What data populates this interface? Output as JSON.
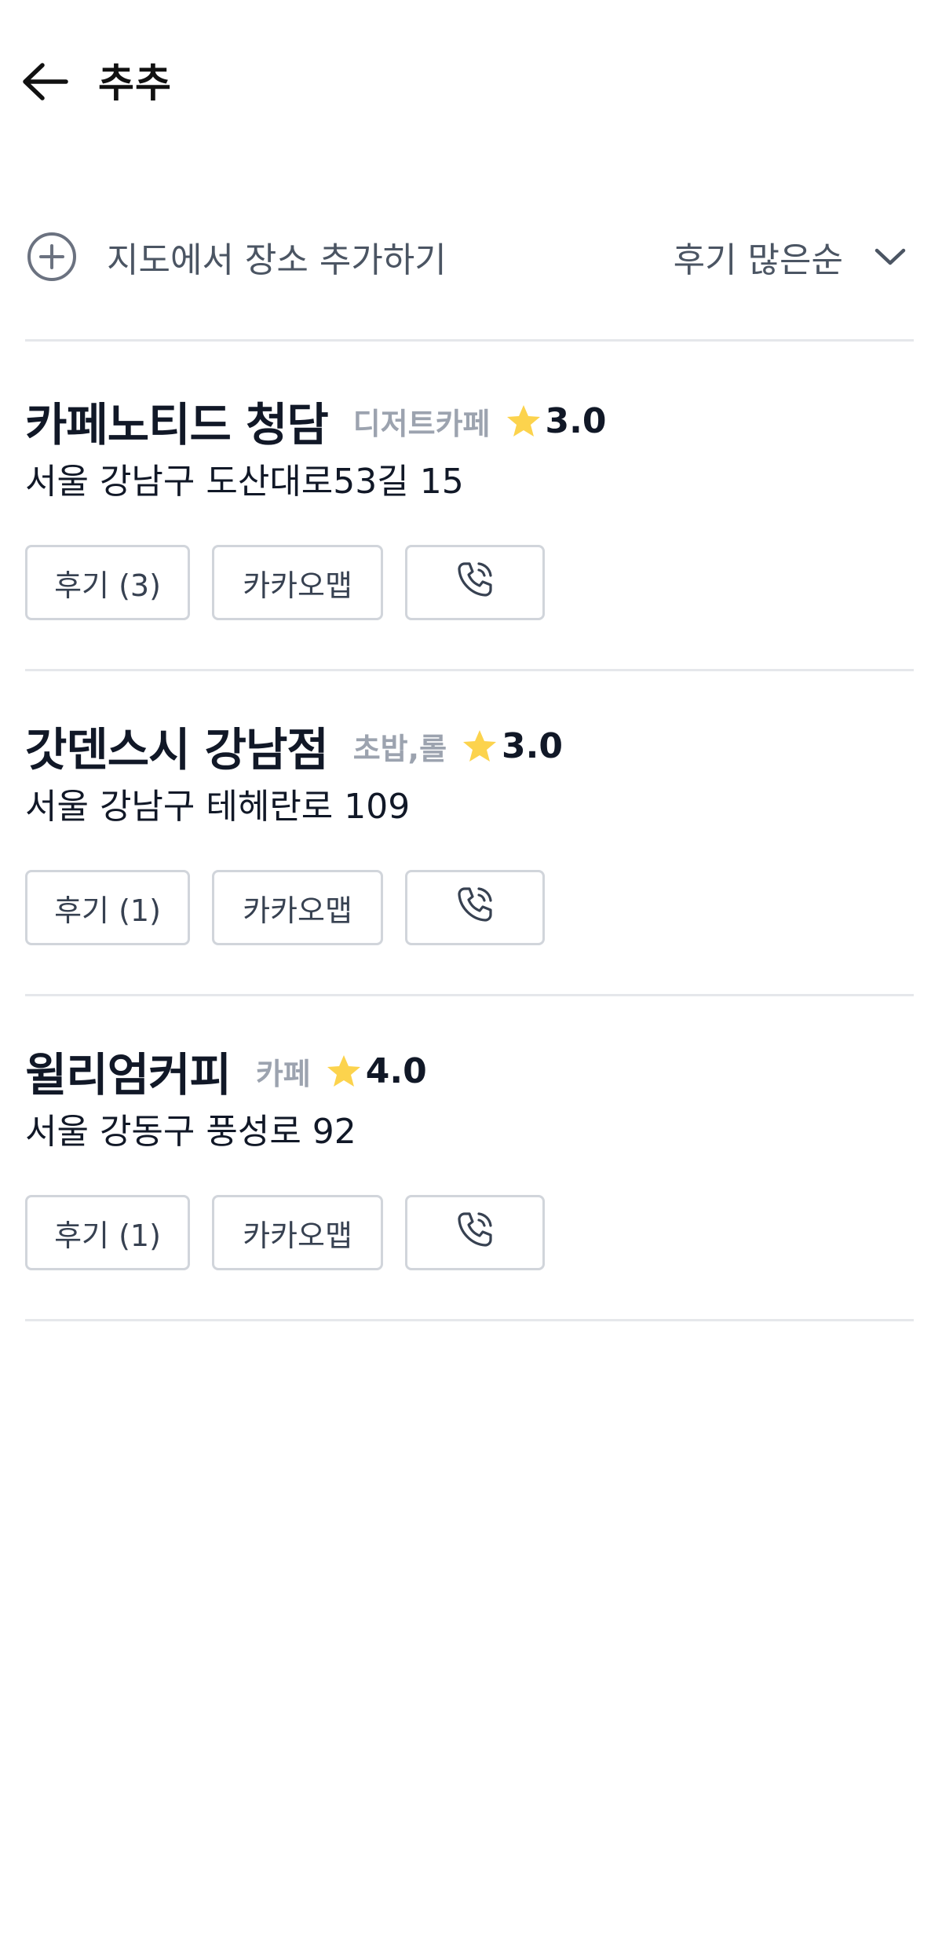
{
  "header": {
    "title": "추추",
    "back_icon": "arrow-left-icon"
  },
  "toolbar": {
    "add_place_label": "지도에서 장소 추가하기",
    "add_icon": "plus-circle-icon",
    "sort_label": "후기 많은순",
    "sort_icon": "chevron-down-icon"
  },
  "colors": {
    "text_primary": "#111827",
    "text_secondary": "#4b5563",
    "text_muted": "#9ca3af",
    "star": "#fcd34d",
    "border": "#d1d5db",
    "divider": "#e5e7eb"
  },
  "places": [
    {
      "name": "카페노티드 청담",
      "category": "디저트카페",
      "rating": "3.0",
      "address": "서울 강남구 도산대로53길 15",
      "review_button": "후기 (3)",
      "map_button": "카카오맵",
      "call_icon": "phone-icon"
    },
    {
      "name": "갓덴스시 강남점",
      "category": "초밥,롤",
      "rating": "3.0",
      "address": "서울 강남구 테헤란로 109",
      "review_button": "후기 (1)",
      "map_button": "카카오맵",
      "call_icon": "phone-icon"
    },
    {
      "name": "윌리엄커피",
      "category": "카페",
      "rating": "4.0",
      "address": "서울 강동구 풍성로 92",
      "review_button": "후기 (1)",
      "map_button": "카카오맵",
      "call_icon": "phone-icon"
    }
  ]
}
